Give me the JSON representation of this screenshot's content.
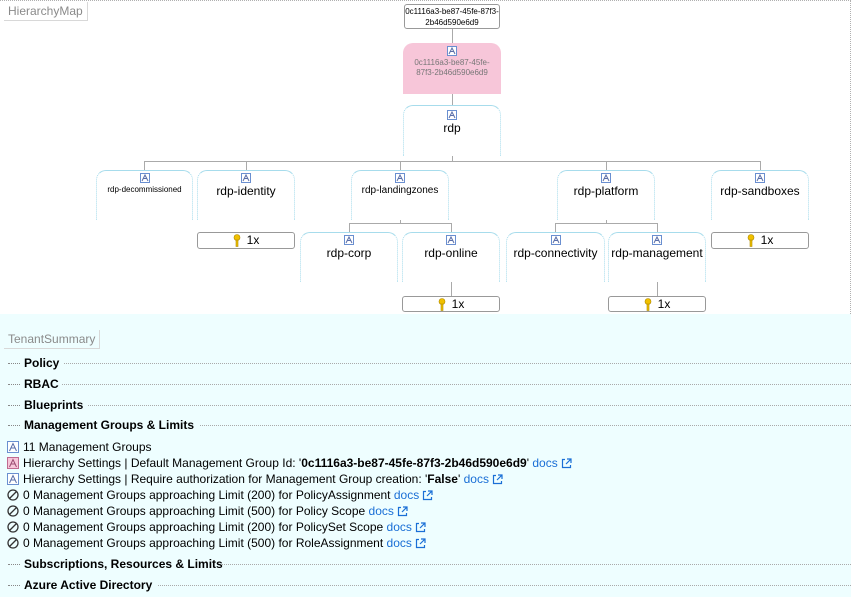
{
  "hierarchy": {
    "tag": "HierarchyMap",
    "tenant": "0c1116a3-be87-45fe-87f3-2b46d590e6d9",
    "root_group": "0c1116a3-be87-45fe-87f3-2b46d590e6d9",
    "rdp": "rdp",
    "children": {
      "decommissioned": "rdp-decommissioned",
      "identity": "rdp-identity",
      "landingzones": "rdp-landingzones",
      "platform": "rdp-platform",
      "sandboxes": "rdp-sandboxes",
      "corp": "rdp-corp",
      "online": "rdp-online",
      "connectivity": "rdp-connectivity",
      "management": "rdp-management"
    },
    "subscription_count": "1x"
  },
  "summary": {
    "tag": "TenantSummary",
    "sections": {
      "policy": "Policy",
      "rbac": "RBAC",
      "blueprints": "Blueprints",
      "mg_limits": "Management Groups & Limits",
      "subs_limits": "Subscriptions, Resources & Limits",
      "aad": "Azure Active Directory"
    },
    "lines": {
      "l1": "11 Management Groups",
      "l2": "Hierarchy Settings | Default Management Group Id: '",
      "l2_id": "0c1116a3-be87-45fe-87f3-2b46d590e6d9",
      "l2_end": "'",
      "l3": "Hierarchy Settings | Require authorization for Management Group creation: '",
      "l3_val": "False",
      "l3_end": "'",
      "l4": "0 Management Groups approaching Limit (200) for PolicyAssignment",
      "l5": "0 Management Groups approaching Limit (500) for Policy Scope",
      "l6": "0 Management Groups approaching Limit (200) for PolicySet Scope",
      "l7": "0 Management Groups approaching Limit (500) for RoleAssignment"
    },
    "docs_label": "docs"
  },
  "colors": {
    "accent_link": "#1a6fd6",
    "node_border": "#a7dcec",
    "root_fill": "#f7c6d9",
    "summary_bg": "#eefeff",
    "key": "#f0c000"
  }
}
